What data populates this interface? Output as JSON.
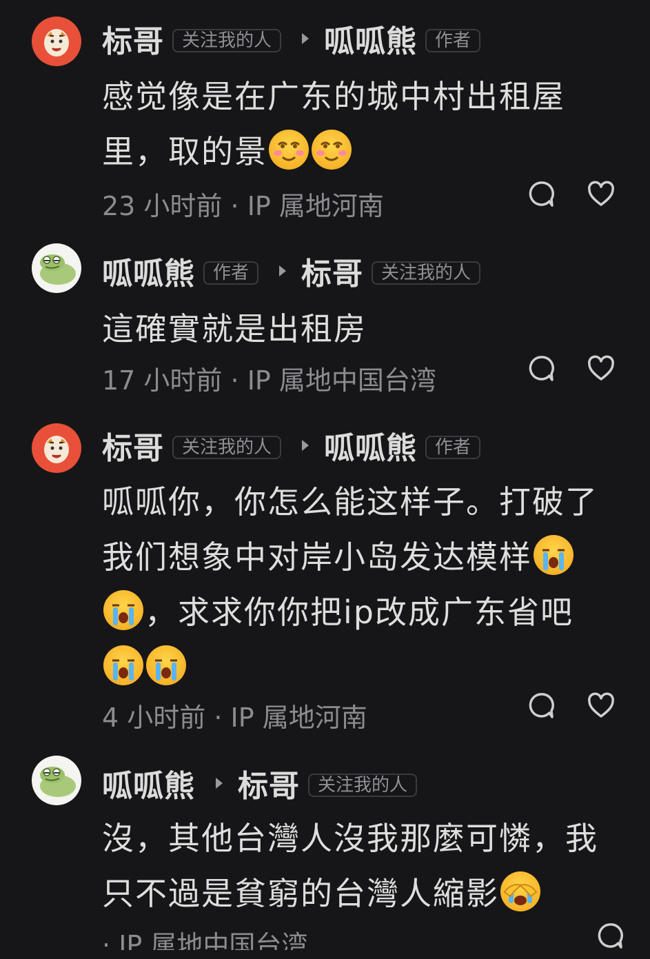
{
  "comments": [
    {
      "user": "标哥",
      "user_tag": "关注我的人",
      "reply_to": "呱呱熊",
      "reply_tag": "作者",
      "text_part1": "感觉像是在广东的城中村出租屋",
      "text_part2": "里，取的景",
      "emojis": [
        "smirk-face",
        "smirk-face"
      ],
      "time": "23 小时前",
      "location": "IP 属地河南"
    },
    {
      "user": "呱呱熊",
      "user_tag": "作者",
      "reply_to": "标哥",
      "reply_tag": "关注我的人",
      "text_part1": "這確實就是出租房",
      "time": "17 小时前",
      "location": "IP 属地中国台湾"
    },
    {
      "user": "标哥",
      "user_tag": "关注我的人",
      "reply_to": "呱呱熊",
      "reply_tag": "作者",
      "text_part1": "呱呱你，你怎么能这样子。打破了",
      "text_part2": "我们想象中对岸小岛发达模样",
      "text_part3": "，求求你你把ip改成广东省吧",
      "emojis": [
        "crying-face",
        "crying-face",
        "crying-face",
        "crying-face"
      ],
      "time": "4 小时前",
      "location": "IP 属地河南"
    },
    {
      "user": "呱呱熊",
      "reply_to": "标哥",
      "reply_tag": "关注我的人",
      "text_part1": "沒，其他台灣人沒我那麼可憐，我",
      "text_part2": "只不過是貧窮的台灣人縮影",
      "emojis": [
        "facepalm-cry-face"
      ],
      "time": "",
      "location": "IP 属地中国台湾"
    }
  ],
  "meta_separator": "·",
  "colors": {
    "background": "#161618",
    "text": "#dedede",
    "muted": "#8c8c90"
  }
}
